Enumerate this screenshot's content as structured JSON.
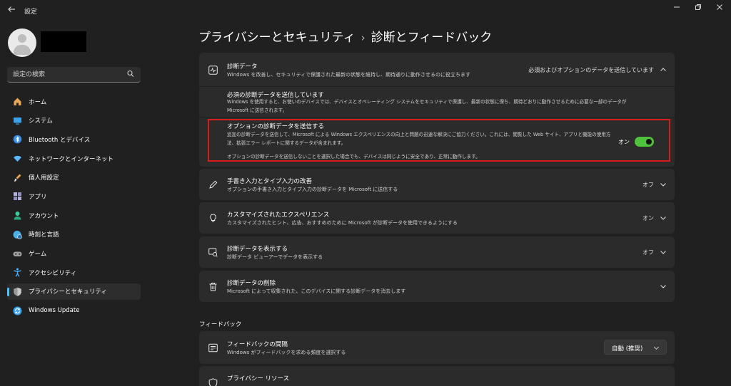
{
  "window": {
    "title": "設定",
    "back_icon": "back-arrow-icon"
  },
  "sidebar": {
    "search_placeholder": "設定の検索",
    "items": [
      {
        "label": "ホーム",
        "icon": "home-icon",
        "color": "#e8a65a"
      },
      {
        "label": "システム",
        "icon": "system-icon",
        "color": "#3aa3e8"
      },
      {
        "label": "Bluetooth とデバイス",
        "icon": "bluetooth-icon",
        "color": "#3a8fe8"
      },
      {
        "label": "ネットワークとインターネット",
        "icon": "wifi-icon",
        "color": "#5cb8ff"
      },
      {
        "label": "個人用設定",
        "icon": "brush-icon",
        "color": "#e8a04a"
      },
      {
        "label": "アプリ",
        "icon": "apps-icon",
        "color": "#b0b0d8"
      },
      {
        "label": "アカウント",
        "icon": "account-icon",
        "color": "#3acf9a"
      },
      {
        "label": "時刻と言語",
        "icon": "globe-clock-icon",
        "color": "#4ab0e8"
      },
      {
        "label": "ゲーム",
        "icon": "gamepad-icon",
        "color": "#a0a0a0"
      },
      {
        "label": "アクセシビリティ",
        "icon": "accessibility-icon",
        "color": "#4ab0ff"
      },
      {
        "label": "プライバシーとセキュリティ",
        "icon": "shield-icon",
        "color": "#9a9a9a",
        "active": true
      },
      {
        "label": "Windows Update",
        "icon": "update-icon",
        "color": "#3aa3e8"
      }
    ]
  },
  "header": {
    "parent": "プライバシーとセキュリティ",
    "separator": "›",
    "title": "診断とフィードバック"
  },
  "diagnostics": {
    "title": "診断データ",
    "desc": "Windows を改善し、セキュリティで保護された最新の状態を維持し、期待通りに動作させるのに役立ちます",
    "state": "必須およびオプションのデータを送信しています",
    "required": {
      "title": "必須の診断データを送信しています",
      "desc": "Windows を使用すると、お使いのデバイスでは、デバイスとオペレーティング システムをセキュリティで保護し、最新の状態に保ち、期待どおりに動作させるために必要な一部のデータが Microsoft に送信されます。"
    },
    "optional": {
      "title": "オプションの診断データを送信する",
      "desc": "追加の診断データを送信して、Microsoft による Windows エクスペリエンスの向上と問題の迅速な解決にご協力ください。これには、閲覧した Web サイト、アプリと機能の使用方法、拡張エラー レポートに関するデータが含まれます。",
      "desc2": "オプションの診断データを送信しないことを選択した場合でも、デバイスは同じように安全であり、正常に動作します。",
      "toggle_label": "オン",
      "toggle_on": true
    }
  },
  "rows": [
    {
      "title": "手書き入力とタイプ入力の改善",
      "desc": "オプションの手書き入力とタイプ入力の診断データを Microsoft に送信する",
      "state": "オフ",
      "icon": "pen-icon"
    },
    {
      "title": "カスタマイズされたエクスペリエンス",
      "desc": "カスタマイズされたヒント、広告、おすすめのために Microsoft が診断データを使用できるようにする",
      "state": "オン",
      "icon": "lightbulb-icon"
    },
    {
      "title": "診断データを表示する",
      "desc": "診断データ ビューアーでデータを表示する",
      "state": "オフ",
      "icon": "data-viewer-icon"
    },
    {
      "title": "診断データの削除",
      "desc": "Microsoft によって収集された、このデバイスに関する診断データを消去します",
      "state": "",
      "icon": "trash-icon"
    }
  ],
  "feedback_section": {
    "heading": "フィードバック",
    "frequency": {
      "title": "フィードバックの間隔",
      "desc": "Windows がフィードバックを求める頻度を選択する",
      "value": "自動 (推奨)",
      "icon": "feedback-icon"
    },
    "privacy": {
      "title": "プライバシー リソース",
      "icon": "shield-outline-icon"
    }
  }
}
